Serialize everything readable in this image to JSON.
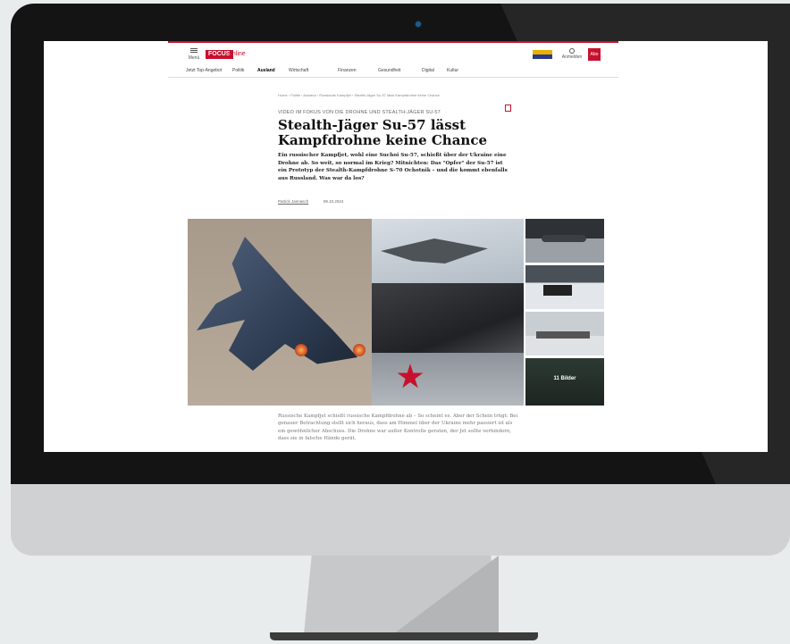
{
  "site": {
    "menu_label": "Menü",
    "logo": "FOCUS",
    "logo_sub": "online",
    "user_label": "Anmelden",
    "red_button": "Abo"
  },
  "nav": {
    "items": [
      "Jetzt Top-Angebot",
      "Politik",
      "Ausland",
      "Wirtschaft",
      "Finanzen",
      "Gesundheit",
      "Digital",
      "Kultur"
    ]
  },
  "article": {
    "breadcrumb": "Home › Politik › Ausland › Russlands Kampfjet › Stealth-Jäger Su-57 lässt Kampfdrohne keine Chance",
    "kicker": "VIDEO IM FOKUS VON DIE DROHNE UND STEALTH-JÄGER SU-57",
    "headline": "Stealth-Jäger Su-57 lässt Kampfdrohne keine Chance",
    "lead": "Ein russischer Kampfjet, wohl eine Suchoi Su-57, schießt über der Ukraine eine Drohne ab. So weit, so normal im Krieg? Mitnichten: Das \"Opfer\" der Su-57 ist ein Prototyp der Stealth-Kampfdrohne S-70 Ochotnik – und die kommt ebenfalls aus Russland. Was war da los?",
    "author": "Patrick Jannasch",
    "date": "09.10.2024",
    "body": "Russische Kampfjet schießt russische Kampfdrohne ab – So scheint es. Aber der Schein trügt: Bei genauer Betrachtung stellt sich heraus, dass am Himmel über der Ukraine mehr passiert ist als ein gewöhnlicher Abschuss. Die Drohne war außer Kontrolle geraten, der Jet sollte verhindern, dass sie in falsche Hände gerät."
  },
  "gallery": {
    "more_label": "11 Bilder"
  },
  "colors": {
    "accent": "#c8102e",
    "monitor_bezel": "#141414",
    "monitor_chin": "#cfd1d3",
    "background": "#e9eced"
  }
}
